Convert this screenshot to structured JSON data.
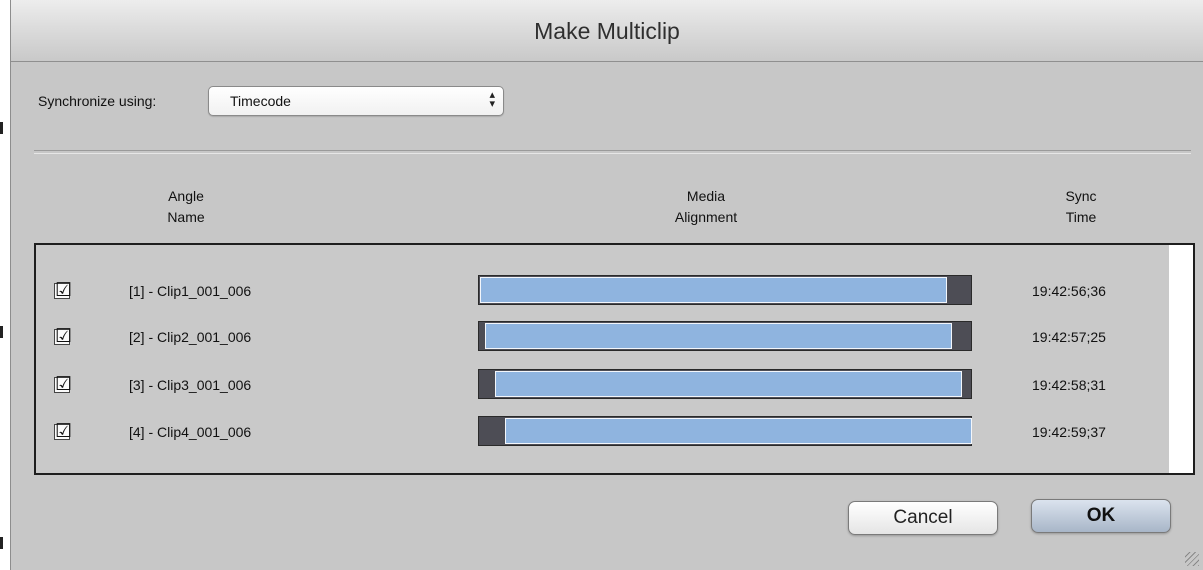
{
  "window": {
    "title": "Make Multiclip"
  },
  "sync": {
    "label": "Synchronize using:",
    "value": "Timecode",
    "arrows_icon": "up-down-arrows-icon"
  },
  "columns": {
    "angle_name": [
      "Angle",
      "Name"
    ],
    "media_alignment": [
      "Media",
      "Alignment"
    ],
    "sync_time": [
      "Sync",
      "Time"
    ]
  },
  "colors": {
    "track": "#4d4d55",
    "clip_fill": "#8fb4df"
  },
  "clips": [
    {
      "checked": true,
      "check_glyph": "☑",
      "name": "[1] - Clip1_001_006",
      "alignment_start": 0.0,
      "alignment_end": 0.95,
      "sync_time": "19:42:56;36"
    },
    {
      "checked": true,
      "check_glyph": "☑",
      "name": "[2] - Clip2_001_006",
      "alignment_start": 0.01,
      "alignment_end": 0.96,
      "sync_time": "19:42:57;25"
    },
    {
      "checked": true,
      "check_glyph": "☑",
      "name": "[3] - Clip3_001_006",
      "alignment_start": 0.03,
      "alignment_end": 0.98,
      "sync_time": "19:42:58;31"
    },
    {
      "checked": true,
      "check_glyph": "☑",
      "name": "[4] - Clip4_001_006",
      "alignment_start": 0.05,
      "alignment_end": 1.0,
      "sync_time": "19:42:59;37"
    }
  ],
  "buttons": {
    "cancel": "Cancel",
    "ok": "OK"
  }
}
